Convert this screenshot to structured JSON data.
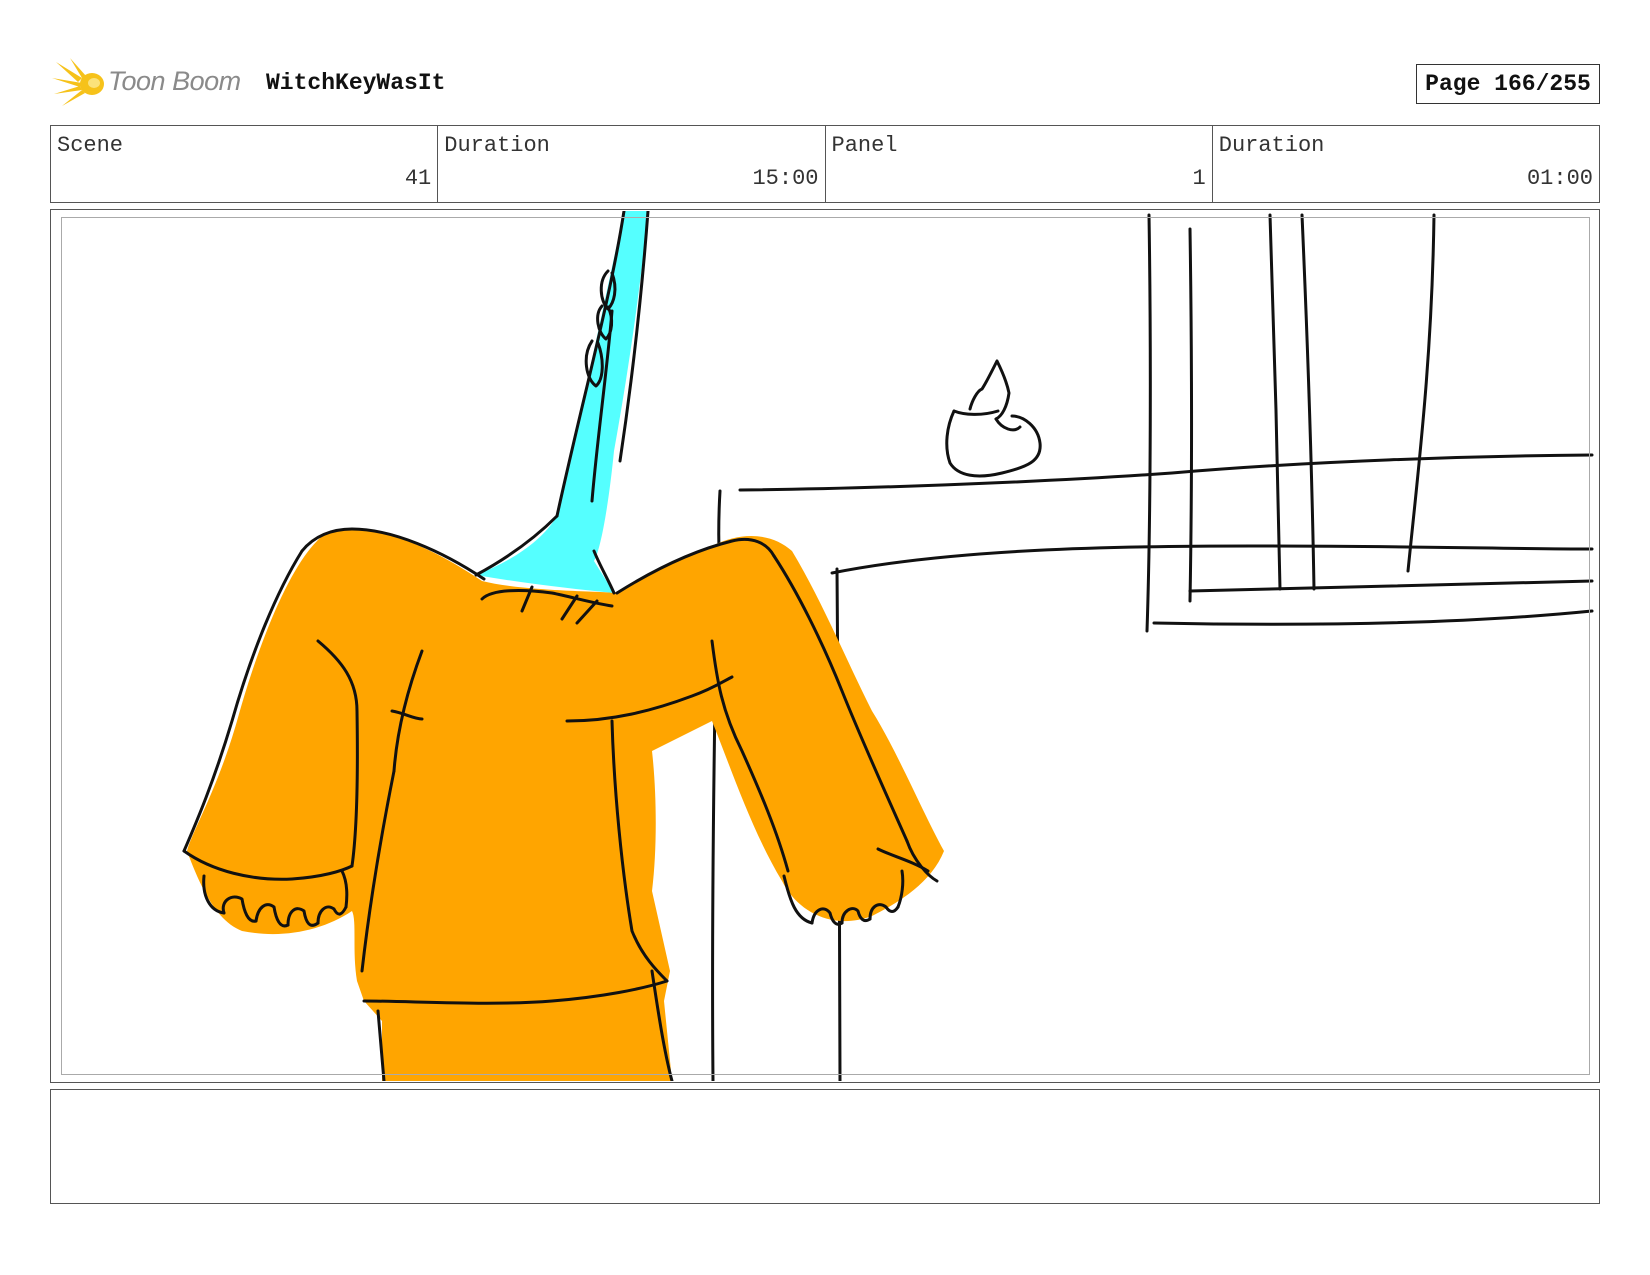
{
  "header": {
    "brand_name": "Toon Boom",
    "project_title": "WitchKeyWasIt",
    "page_label": "Page 166/255"
  },
  "info": {
    "scene_label": "Scene",
    "scene_value": "41",
    "scene_duration_label": "Duration",
    "scene_duration_value": "15:00",
    "panel_label": "Panel",
    "panel_value": "1",
    "panel_duration_label": "Duration",
    "panel_duration_value": "01:00"
  },
  "colors": {
    "character_body": "#FFA500",
    "character_neck": "#55FFFF",
    "line_ink": "#111111",
    "logo_star": "#F6C21A"
  },
  "notes": {
    "text": ""
  }
}
